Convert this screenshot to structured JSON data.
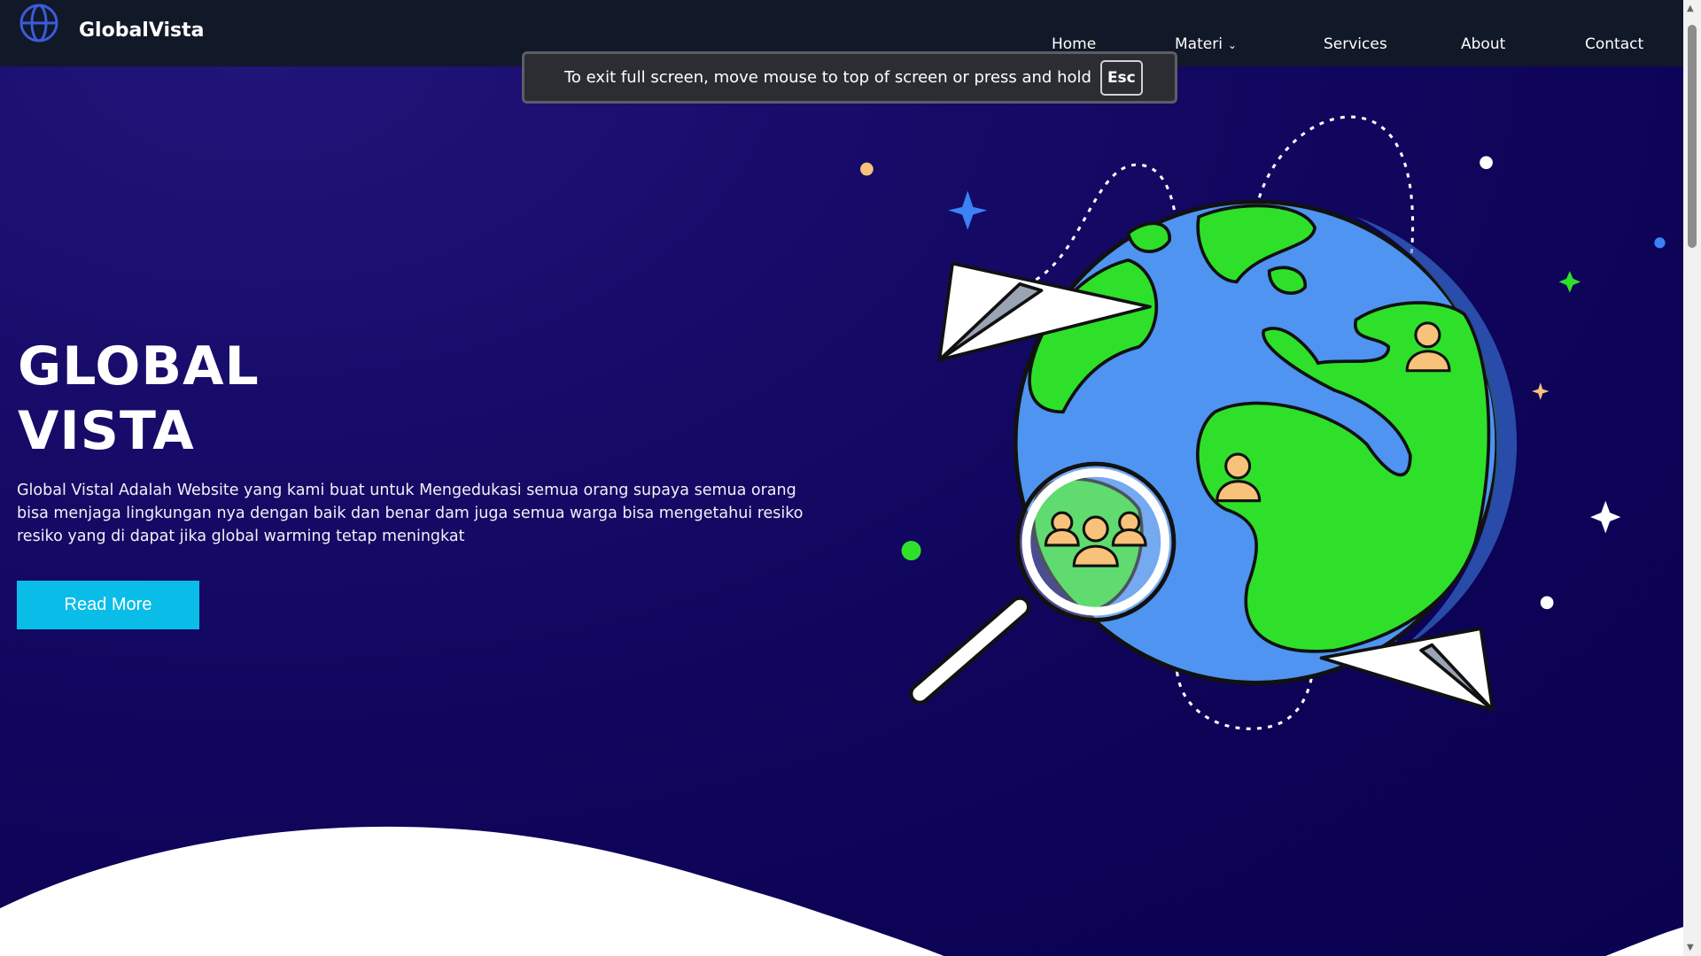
{
  "nav": {
    "brand": "GlobalVista",
    "items": [
      {
        "label": "Home"
      },
      {
        "label": "Materi",
        "dropdown": true
      },
      {
        "label": "Services"
      },
      {
        "label": "About"
      },
      {
        "label": "Contact"
      }
    ]
  },
  "toast": {
    "message": "To exit full screen, move mouse to top of screen or press and hold",
    "key": "Esc"
  },
  "hero": {
    "title_line1": "GLOBAL",
    "title_line2": "VISTA",
    "description": "Global Vistal Adalah Website yang kami buat untuk Mengedukasi semua orang supaya semua orang bisa menjaga lingkungan nya dengan baik dan benar dam juga semua warga bisa mengetahui resiko resiko yang di dapat jika global warming tetap meningkat",
    "button_label": "Read More"
  },
  "colors": {
    "accent": "#0abde8",
    "nav_bg": "#111827",
    "ocean": "#4f94f0",
    "land": "#2ee02a"
  }
}
